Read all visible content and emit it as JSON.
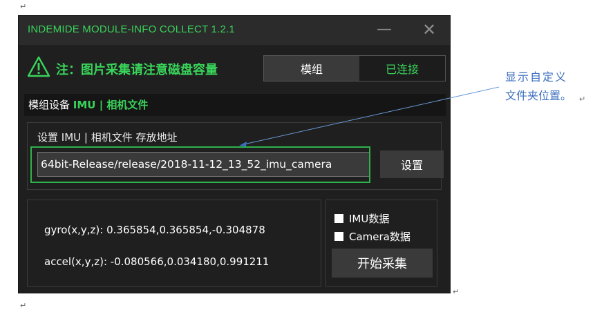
{
  "doc": {
    "return_mark": "↵"
  },
  "window": {
    "title": "INDEMIDE MODULE-INFO COLLECT 1.2.1",
    "minimize_glyph": "—",
    "close_glyph": "✕"
  },
  "warning": {
    "icon": "warning-triangle-icon",
    "text": "注：图片采集请注意磁盘容量"
  },
  "status": {
    "module_label": "模组",
    "connection_status": "已连接"
  },
  "section": {
    "prefix": "模组设备 ",
    "highlight": "IMU | 相机文件"
  },
  "storage": {
    "label": "设置 IMU | 相机文件 存放地址",
    "path_value": "64bit-Release/release/2018-11-12_13_52_imu_camera",
    "set_button": "设置"
  },
  "readings": {
    "gyro": "gyro(x,y,z): 0.365854,0.365854,-0.304878",
    "accel": "accel(x,y,z): -0.080566,0.034180,0.991211"
  },
  "options": {
    "imu_data": "IMU数据",
    "camera_data": "Camera数据",
    "start_button": "开始采集"
  },
  "annotation": {
    "line1": "显示自定义",
    "line2": "文件夹位置。"
  },
  "colors": {
    "accent_green": "#39d45a",
    "annotation_blue": "#3c6fbf",
    "window_bg": "#1f1f1f"
  }
}
